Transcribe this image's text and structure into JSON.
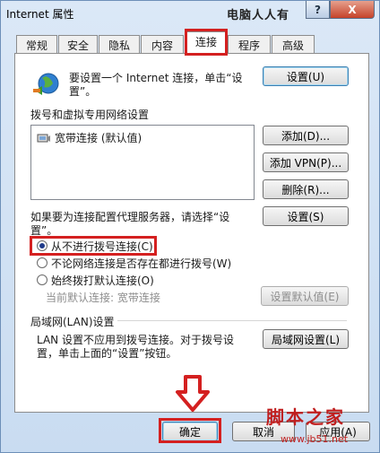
{
  "window": {
    "title": "Internet 属性",
    "watermark_top": "电脑人人有",
    "help": "?",
    "close": "X"
  },
  "tabs": [
    {
      "label": "常规"
    },
    {
      "label": "安全"
    },
    {
      "label": "隐私"
    },
    {
      "label": "内容"
    },
    {
      "label": "连接",
      "active": true
    },
    {
      "label": "程序"
    },
    {
      "label": "高级"
    }
  ],
  "setup": {
    "text_line1": "要设置一个 Internet 连接，单击“设",
    "text_line2": "置”。",
    "button": "设置(U)"
  },
  "dialup": {
    "group_label": "拨号和虚拟专用网络设置",
    "items": [
      {
        "label": "宽带连接 (默认值)"
      }
    ],
    "add_button": "添加(D)...",
    "add_vpn_button": "添加 VPN(P)...",
    "delete_button": "删除(R)...",
    "proxy_text_line1": "如果要为连接配置代理服务器，请选择“设",
    "proxy_text_line2": "置”。",
    "settings_button": "设置(S)"
  },
  "dial_options": {
    "never": "从不进行拨号连接(C)",
    "when_no_network": "不论网络连接是否存在都进行拨号(W)",
    "always": "始终拨打默认连接(O)",
    "current_default": "当前默认连接: 宽带连接",
    "set_default_button": "设置默认值(E)"
  },
  "lan": {
    "group_label": "局域网(LAN)设置",
    "text_line1": "LAN 设置不应用到拨号连接。对于拨号设",
    "text_line2": "置，单击上面的“设置”按钮。",
    "button": "局域网设置(L)"
  },
  "footer": {
    "ok": "确定",
    "cancel": "取消",
    "apply": "应用(A)"
  },
  "watermark_bottom": {
    "text": "脚本之家",
    "url": "www.jb51.net"
  },
  "colors": {
    "highlight": "#d42020",
    "accent_blue": "#3c7fb1"
  }
}
